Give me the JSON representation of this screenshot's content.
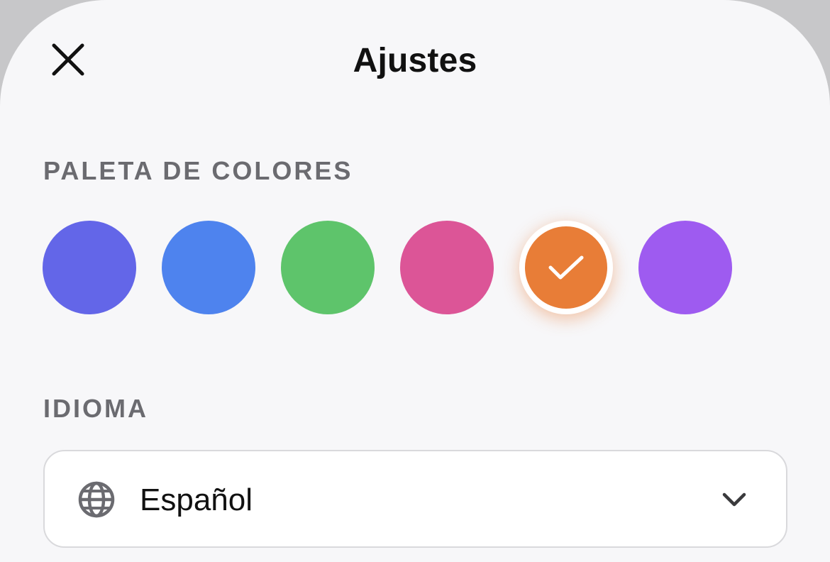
{
  "header": {
    "title": "Ajustes",
    "close_icon": "close-icon"
  },
  "palette": {
    "label": "PALETA DE COLORES",
    "colors": [
      {
        "name": "indigo",
        "hex": "#6366e8",
        "selected": false
      },
      {
        "name": "blue",
        "hex": "#4e83ee",
        "selected": false
      },
      {
        "name": "green",
        "hex": "#5ec46b",
        "selected": false
      },
      {
        "name": "pink",
        "hex": "#dc5597",
        "selected": false
      },
      {
        "name": "orange",
        "hex": "#e87d37",
        "selected": true
      },
      {
        "name": "purple",
        "hex": "#9e5bf0",
        "selected": false
      }
    ],
    "selected_icon": "check-icon"
  },
  "language": {
    "label": "IDIOMA",
    "value": "Español",
    "icon": "globe-icon",
    "dropdown_icon": "chevron-down-icon"
  }
}
